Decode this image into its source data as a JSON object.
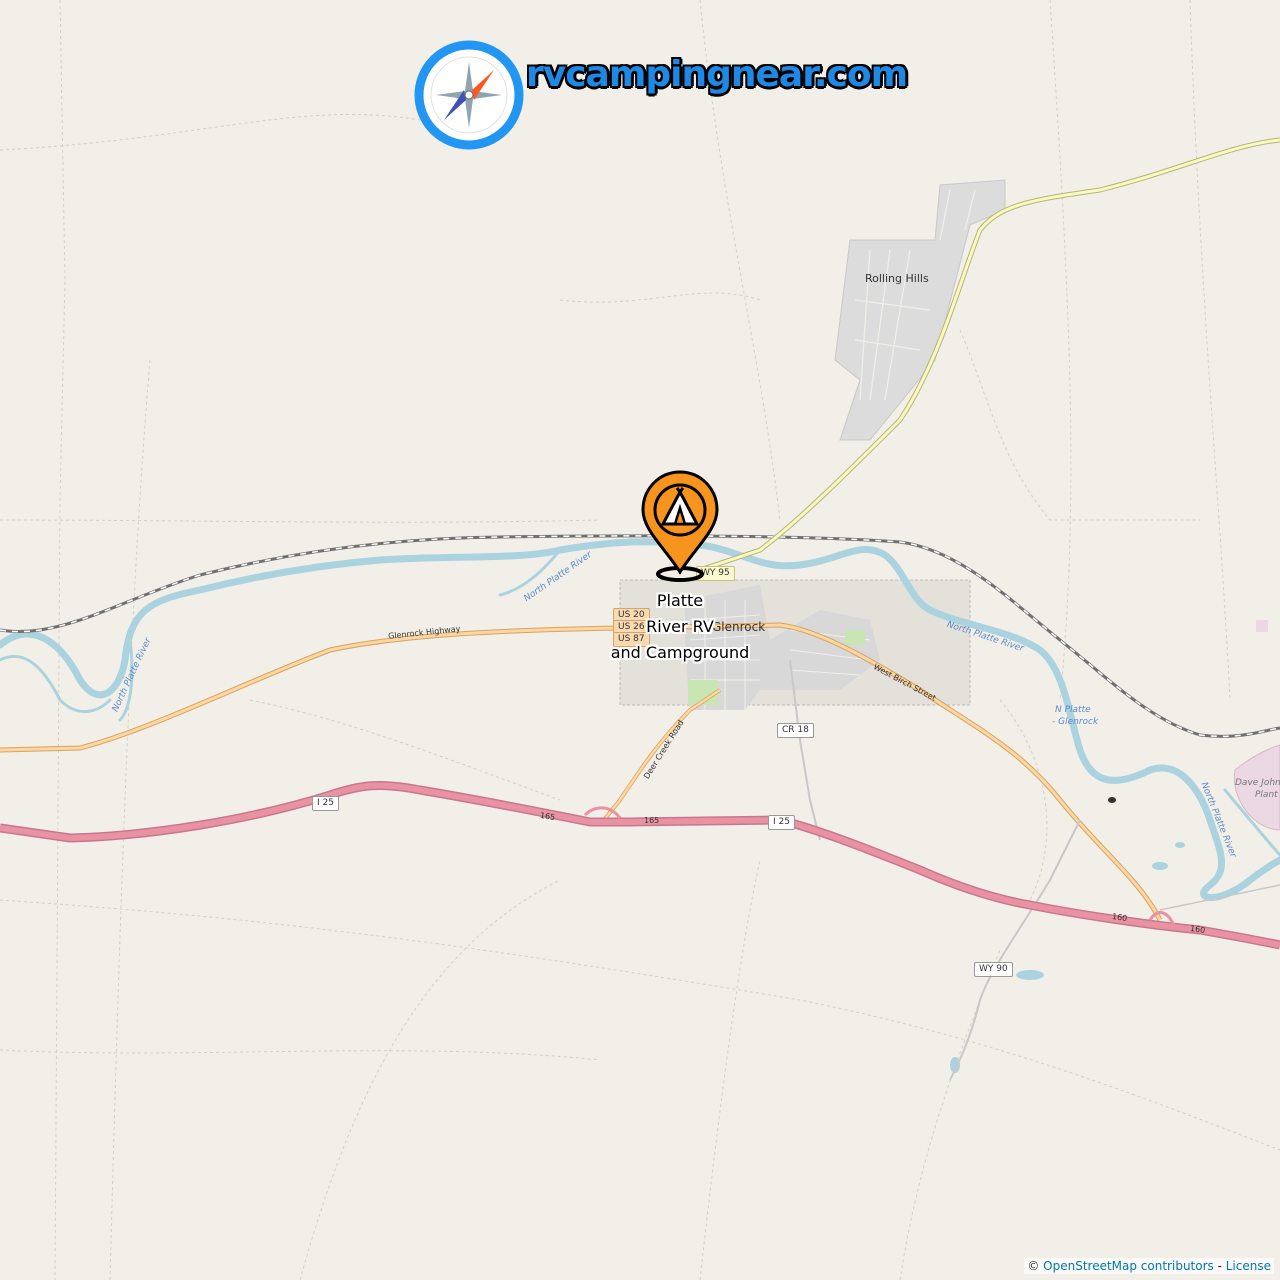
{
  "brand": {
    "text": "rvcampingnear.com",
    "icon": "compass-icon"
  },
  "marker": {
    "name_lines": [
      "Platte",
      "River RV",
      "and Campground"
    ],
    "icon": "tent-icon",
    "color": "#f7941d"
  },
  "places": {
    "rolling_hills": "Rolling Hills",
    "glenrock": "Glenrock",
    "dave_johnston_1": "Dave Johnston",
    "dave_johnston_2": "Plant"
  },
  "rivers": {
    "north_platte_1": "North Platte River",
    "north_platte_2": "North Platte River",
    "north_platte_3": "North Platte River",
    "north_platte_4": "North Platte River",
    "n_platte_glenrock_1": "N Platte",
    "n_platte_glenrock_2": "- Glenrock"
  },
  "roads": {
    "glenrock_highway": "Glenrock Highway",
    "deer_creek_road": "Deer Creek Road",
    "west_birch_street": "West Birch Street",
    "exit_165a": "165",
    "exit_165b": "165",
    "exit_160a": "160",
    "exit_160b": "160"
  },
  "shields": {
    "wy95": "WY 95",
    "us20": "US 20",
    "us26": "US 26",
    "us87": "US 87",
    "cr18": "CR 18",
    "i25a": "I 25",
    "i25b": "I 25",
    "wy90": "WY 90"
  },
  "attribution": {
    "copyright": "©",
    "osm_link": "OpenStreetMap contributors",
    "separator": " - ",
    "license_link": "License"
  }
}
